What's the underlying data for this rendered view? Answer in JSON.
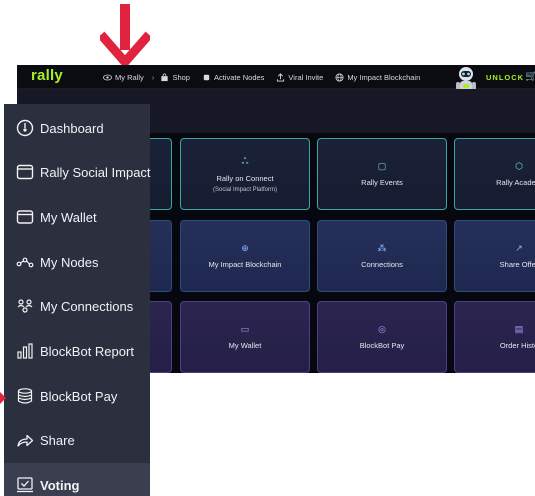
{
  "app": {
    "logo": "rally",
    "nav": [
      {
        "label": "My Rally",
        "icon": "eye-icon"
      },
      {
        "label": "Shop",
        "icon": "shopping-bag-icon"
      },
      {
        "label": "Activate Nodes",
        "icon": "node-icon"
      },
      {
        "label": "Viral Invite",
        "icon": "upload-icon"
      },
      {
        "label": "My Impact Blockchain",
        "icon": "globe-icon"
      }
    ],
    "unlock_label": "UNLOCK",
    "tiles": [
      {
        "label": "Rally on Connect",
        "sub": "(Social Impact Platform)",
        "icon": "people-icon"
      },
      {
        "label": "Rally Events",
        "icon": "chat-icon"
      },
      {
        "label": "Rally Academ",
        "icon": "cube-icon"
      },
      {
        "label": "My Impact Blockchain",
        "icon": "globe-icon"
      },
      {
        "label": "Connections",
        "icon": "connections-icon"
      },
      {
        "label": "Share Offer",
        "icon": "share-icon"
      },
      {
        "label": "My Wallet",
        "icon": "wallet-icon"
      },
      {
        "label": "BlockBot Pay",
        "icon": "coins-icon"
      },
      {
        "label": "Order Histo",
        "icon": "receipt-icon"
      }
    ]
  },
  "sidebar": {
    "items": [
      {
        "label": "Dashboard",
        "icon": "dashboard-icon"
      },
      {
        "label": "Rally Social Impact",
        "icon": "window-icon"
      },
      {
        "label": "My Wallet",
        "icon": "wallet-icon"
      },
      {
        "label": "My Nodes",
        "icon": "nodes-icon"
      },
      {
        "label": "My Connections",
        "icon": "connections-icon"
      },
      {
        "label": "BlockBot Report",
        "icon": "bar-chart-icon"
      },
      {
        "label": "BlockBot Pay",
        "icon": "coins-icon"
      },
      {
        "label": "Share",
        "icon": "share-icon"
      },
      {
        "label": "Voting",
        "icon": "ballot-icon",
        "active": true
      }
    ]
  },
  "colors": {
    "accent": "#a6f02a",
    "arrow": "#e0233f",
    "sidebar_bg": "#2c2f3e",
    "app_bg": "#0d0f17"
  }
}
